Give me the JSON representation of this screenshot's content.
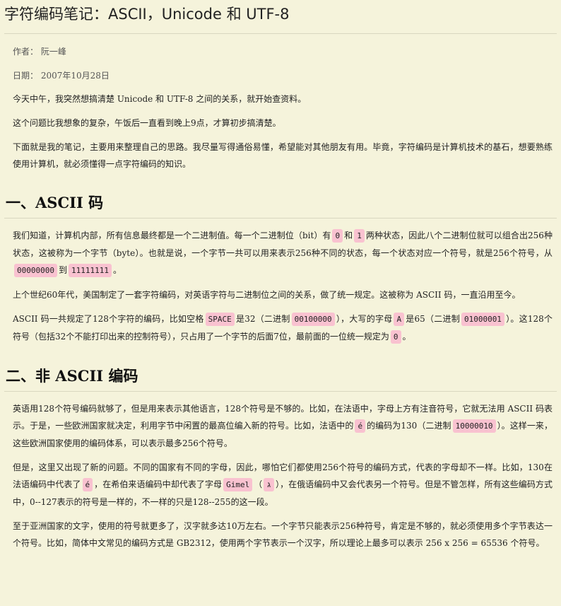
{
  "article": {
    "title": "字符编码笔记：ASCII，Unicode 和 UTF-8",
    "author_label": "作者：",
    "author": "阮一峰",
    "date_label": "日期：",
    "date": "2007年10月28日"
  },
  "intro": [
    "今天中午，我突然想搞清楚 Unicode 和 UTF-8 之间的关系，就开始查资料。",
    "这个问题比我想象的复杂，午饭后一直看到晚上9点，才算初步搞清楚。",
    "下面就是我的笔记，主要用来整理自己的思路。我尽量写得通俗易懂，希望能对其他朋友有用。毕竟，字符编码是计算机技术的基石，想要熟练使用计算机，就必须懂得一点字符编码的知识。"
  ],
  "section1": {
    "heading": "一、ASCII 码",
    "p1": {
      "t1": "我们知道，计算机内部，所有信息最终都是一个二进制值。每一个二进制位（bit）有",
      "c1": "0",
      "t2": "和",
      "c2": "1",
      "t3": "两种状态，因此八个二进制位就可以组合出256种状态，这被称为一个字节（byte）。也就是说，一个字节一共可以用来表示256种不同的状态，每一个状态对应一个符号，就是256个符号，从",
      "c3": "00000000",
      "t4": "到",
      "c4": "11111111",
      "t5": "。"
    },
    "p2": "上个世纪60年代，美国制定了一套字符编码，对英语字符与二进制位之间的关系，做了统一规定。这被称为 ASCII 码，一直沿用至今。",
    "p3": {
      "t1": "ASCII 码一共规定了128个字符的编码，比如空格",
      "c1": "SPACE",
      "t2": "是32（二进制",
      "c2": "00100000",
      "t3": "），大写的字母",
      "c3": "A",
      "t4": "是65（二进制",
      "c4": "01000001",
      "t5": "）。这128个符号（包括32个不能打印出来的控制符号），只占用了一个字节的后面7位，最前面的一位统一规定为",
      "c5": "0",
      "t6": "。"
    }
  },
  "section2": {
    "heading": "二、非 ASCII 编码",
    "p1": {
      "t1": "英语用128个符号编码就够了，但是用来表示其他语言，128个符号是不够的。比如，在法语中，字母上方有注音符号，它就无法用 ASCII 码表示。于是，一些欧洲国家就决定，利用字节中闲置的最高位编入新的符号。比如，法语中的",
      "c1": "é",
      "t2": "的编码为130（二进制",
      "c2": "10000010",
      "t3": "）。这样一来，这些欧洲国家使用的编码体系，可以表示最多256个符号。"
    },
    "p2": {
      "t1": "但是，这里又出现了新的问题。不同的国家有不同的字母，因此，哪怕它们都使用256个符号的编码方式，代表的字母却不一样。比如，130在法语编码中代表了",
      "c1": "é",
      "t2": "，在希伯来语编码中却代表了字母",
      "c2": "Gimel",
      "t3": "（",
      "c3": "ג",
      "t4": "），在俄语编码中又会代表另一个符号。但是不管怎样，所有这些编码方式中，0--127表示的符号是一样的，不一样的只是128--255的这一段。"
    },
    "p3": "至于亚洲国家的文字，使用的符号就更多了，汉字就多达10万左右。一个字节只能表示256种符号，肯定是不够的，就必须使用多个字节表达一个符号。比如，简体中文常见的编码方式是 GB2312，使用两个字节表示一个汉字，所以理论上最多可以表示 256 x 256 = 65536 个符号。"
  }
}
